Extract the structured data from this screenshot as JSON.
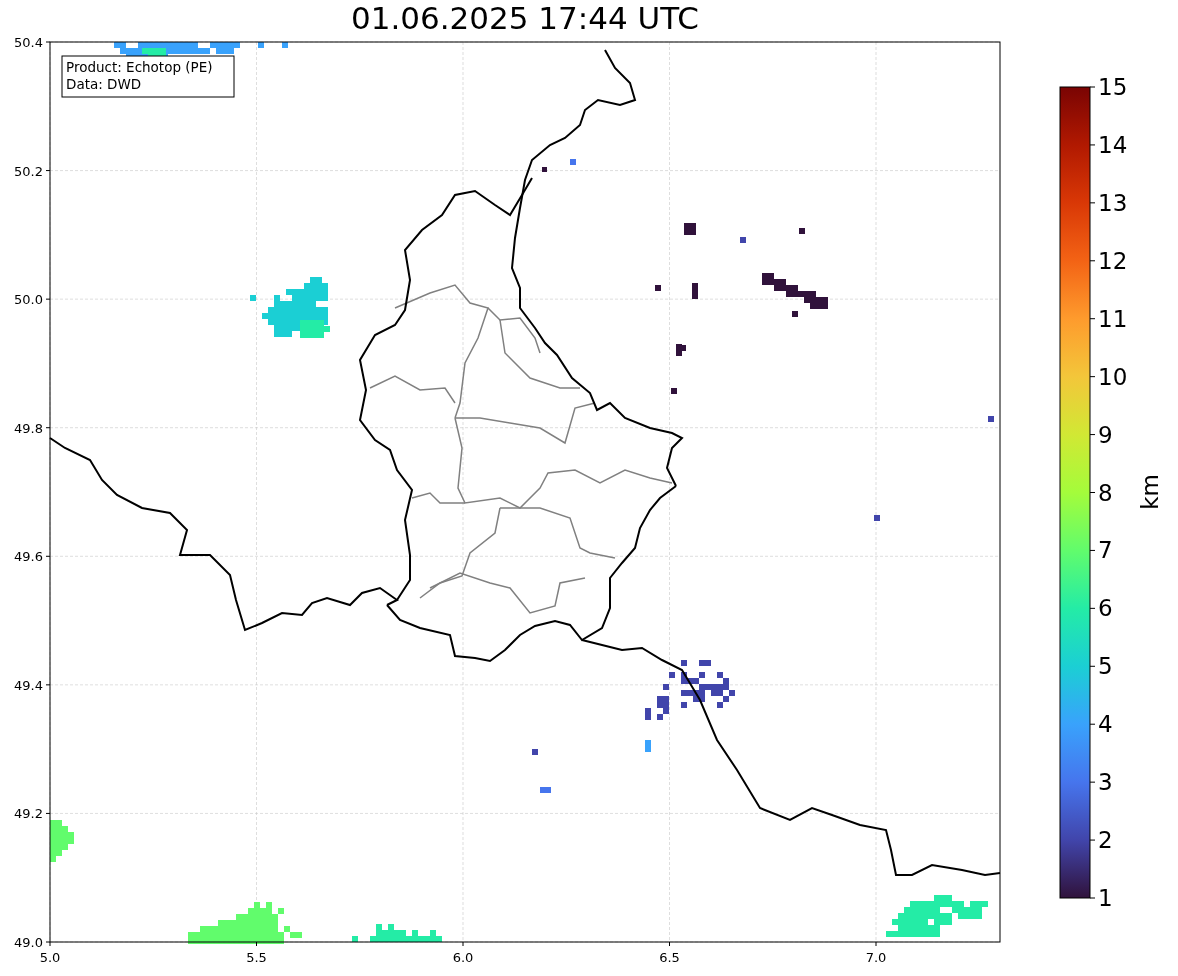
{
  "title": "01.06.2025 17:44 UTC",
  "info_box": [
    "Product: Echotop (PE)",
    "Data: DWD"
  ],
  "map": {
    "xticks": [
      "5.0",
      "5.5",
      "6.0",
      "6.5",
      "7.0"
    ],
    "yticks": [
      "50.4",
      "50.2",
      "50.0",
      "49.8",
      "49.6",
      "49.4",
      "49.2",
      "49.0"
    ]
  },
  "colorbar": {
    "label": "km",
    "ticks": [
      "15",
      "14",
      "13",
      "12",
      "11",
      "10",
      "9",
      "8",
      "7",
      "6",
      "5",
      "4",
      "3",
      "2",
      "1"
    ]
  }
}
